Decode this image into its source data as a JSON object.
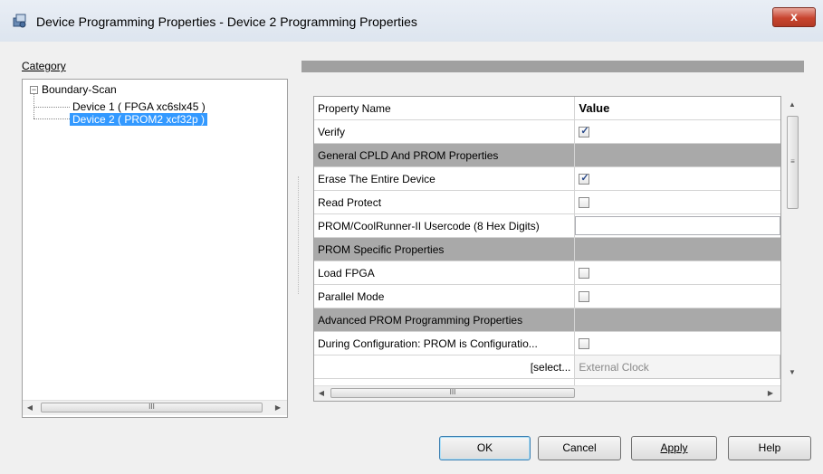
{
  "window": {
    "title": "Device Programming Properties - Device 2 Programming Properties",
    "close_label": "x"
  },
  "category": {
    "label": "Category",
    "tree": {
      "root": "Boundary-Scan",
      "items": [
        {
          "label": "Device 1 ( FPGA xc6slx45 )",
          "selected": false
        },
        {
          "label": "Device 2 ( PROM2 xcf32p )",
          "selected": true
        }
      ]
    },
    "scroll_thumb": "III"
  },
  "properties": {
    "header": {
      "name": "Property Name",
      "value": "Value"
    },
    "rows": [
      {
        "type": "checkbox",
        "name": "Verify",
        "checked": true
      },
      {
        "type": "section",
        "name": "General CPLD And PROM Properties"
      },
      {
        "type": "checkbox",
        "name": "Erase The Entire Device",
        "checked": true
      },
      {
        "type": "checkbox",
        "name": "Read Protect",
        "checked": false
      },
      {
        "type": "text",
        "name": "PROM/CoolRunner-II Usercode (8 Hex Digits)",
        "value": ""
      },
      {
        "type": "section",
        "name": "PROM Specific Properties"
      },
      {
        "type": "checkbox",
        "name": "Load FPGA",
        "checked": false
      },
      {
        "type": "checkbox",
        "name": "Parallel Mode",
        "checked": false
      },
      {
        "type": "section",
        "name": "Advanced PROM Programming Properties"
      },
      {
        "type": "checkbox",
        "name": "During Configuration: PROM is Configuratio...",
        "checked": false
      },
      {
        "type": "disabled",
        "name": "[select...",
        "value": "External Clock"
      }
    ],
    "scroll_thumb": "III"
  },
  "buttons": {
    "ok": "OK",
    "cancel": "Cancel",
    "apply": "Apply",
    "help": "Help"
  }
}
